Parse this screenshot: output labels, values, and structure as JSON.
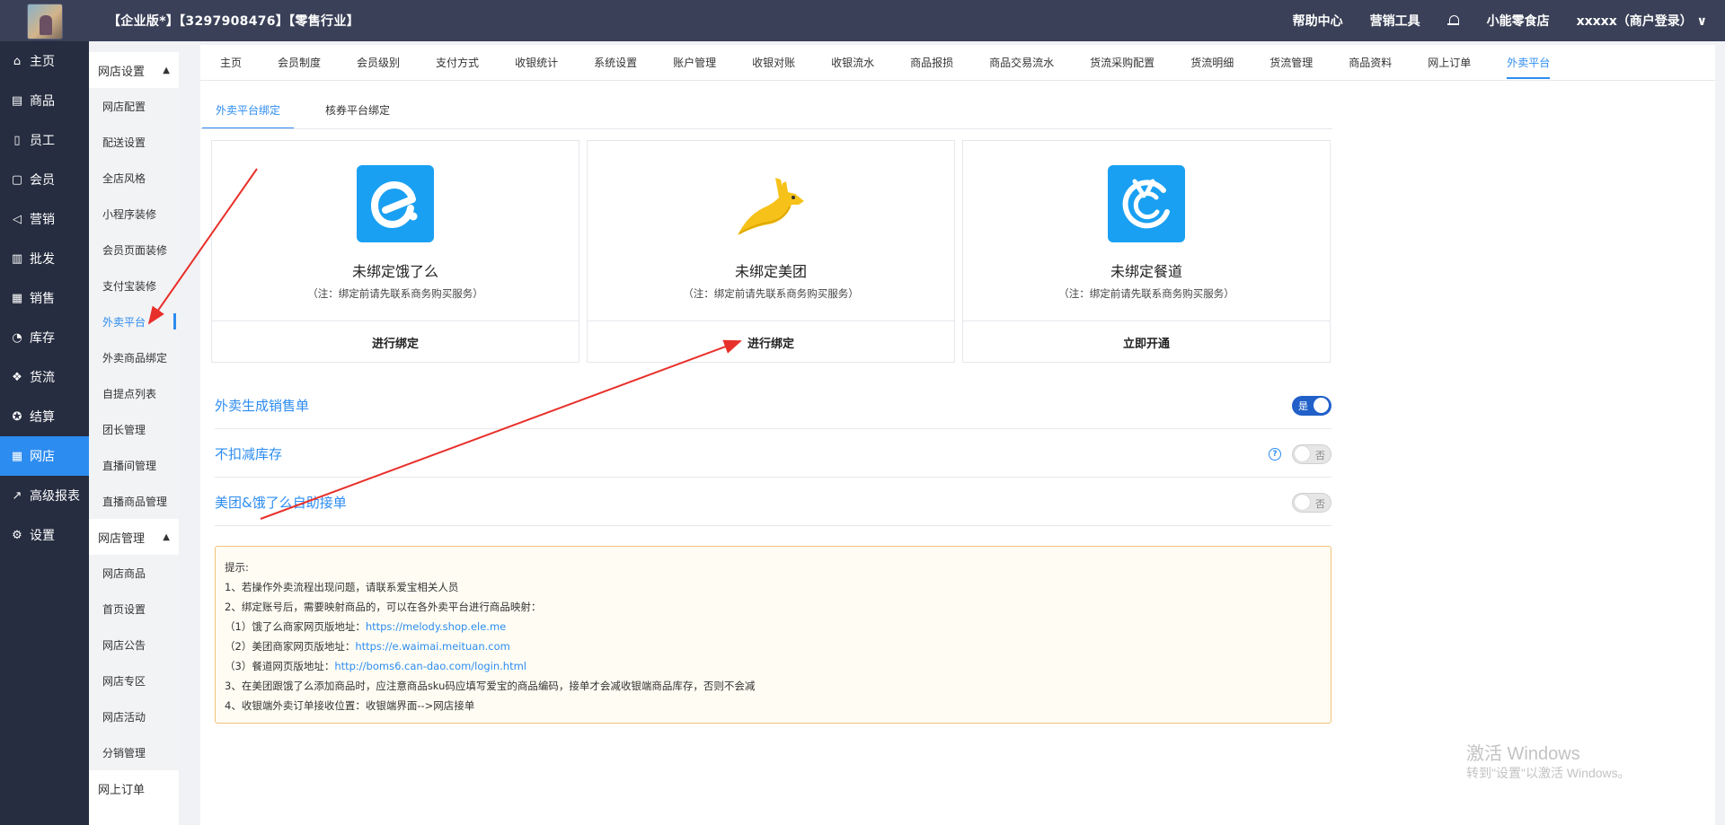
{
  "header": {
    "title": "【企业版*】【3297908476】【零售行业】",
    "help": "帮助中心",
    "marketing": "营销工具",
    "store": "小能零食店",
    "account": "xxxxx（商户登录）"
  },
  "nav": {
    "items": [
      {
        "label": "主页",
        "icon": "home-icon"
      },
      {
        "label": "商品",
        "icon": "goods-icon"
      },
      {
        "label": "员工",
        "icon": "staff-icon"
      },
      {
        "label": "会员",
        "icon": "member-icon"
      },
      {
        "label": "营销",
        "icon": "megaphone-icon"
      },
      {
        "label": "批发",
        "icon": "wholesale-icon"
      },
      {
        "label": "销售",
        "icon": "sales-chart-icon"
      },
      {
        "label": "库存",
        "icon": "stock-pie-icon"
      },
      {
        "label": "货流",
        "icon": "flow-icon"
      },
      {
        "label": "结算",
        "icon": "settle-icon"
      },
      {
        "label": "网店",
        "icon": "shop-icon"
      },
      {
        "label": "高级报表",
        "icon": "report-icon"
      },
      {
        "label": "设置",
        "icon": "settings-gear-icon"
      }
    ]
  },
  "subnav": {
    "group1": "网店设置",
    "group1_items": [
      "网店配置",
      "配送设置",
      "全店风格",
      "小程序装修",
      "会员页面装修",
      "支付宝装修",
      "外卖平台",
      "外卖商品绑定",
      "自提点列表",
      "团长管理",
      "直播间管理",
      "直播商品管理"
    ],
    "group2": "网店管理",
    "group2_items": [
      "网店商品",
      "首页设置",
      "网店公告",
      "网店专区",
      "网店活动",
      "分销管理"
    ],
    "group3": "网上订单"
  },
  "tabs": [
    "主页",
    "会员制度",
    "会员级别",
    "支付方式",
    "收银统计",
    "系统设置",
    "账户管理",
    "收银对账",
    "收银流水",
    "商品报损",
    "商品交易流水",
    "货流采购配置",
    "货流明细",
    "货流管理",
    "商品资料",
    "网上订单",
    "外卖平台"
  ],
  "subtabs": [
    "外卖平台绑定",
    "核券平台绑定"
  ],
  "platforms": [
    {
      "name": "未绑定饿了么",
      "note": "（注：绑定前请先联系商务购买服务）",
      "action": "进行绑定",
      "logo": "eleme-logo-icon"
    },
    {
      "name": "未绑定美团",
      "note": "（注：绑定前请先联系商务购买服务）",
      "action": "进行绑定",
      "logo": "meituan-kangaroo-logo-icon"
    },
    {
      "name": "未绑定餐道",
      "note": "（注：绑定前请先联系商务购买服务）",
      "action": "立即开通",
      "logo": "candao-logo-icon"
    }
  ],
  "settings": [
    {
      "label": "外卖生成销售单",
      "state": "是",
      "on": true
    },
    {
      "label": "不扣减库存",
      "state": "否",
      "on": false
    },
    {
      "label": "美团&饿了么自助接单",
      "state": "否",
      "on": false
    }
  ],
  "tips": {
    "title": "提示:",
    "l1": "1、若操作外卖流程出现问题，请联系爱宝相关人员",
    "l2": "2、绑定账号后，需要映射商品的，可以在各外卖平台进行商品映射：",
    "l3_pre": "（1）饿了么商家网页版地址：",
    "l3_url": "https://melody.shop.ele.me",
    "l4_pre": "（2）美团商家网页版地址：",
    "l4_url": "https://e.waimai.meituan.com",
    "l5_pre": "（3）餐道网页版地址：",
    "l5_url": "http://boms6.can-dao.com/login.html",
    "l6": "3、在美团跟饿了么添加商品时，应注意商品sku码应填写爱宝的商品编码，接单才会减收银端商品库存，否则不会减",
    "l7": "4、收银端外卖订单接收位置：收银端界面-->网店接单"
  },
  "watermark": {
    "line1": "激活 Windows",
    "line2": "转到\"设置\"以激活 Windows。"
  },
  "colors": {
    "accent": "#2d8cf0",
    "header": "#3a4058",
    "sidebar": "#262d40",
    "annotation": "#e8302a"
  }
}
